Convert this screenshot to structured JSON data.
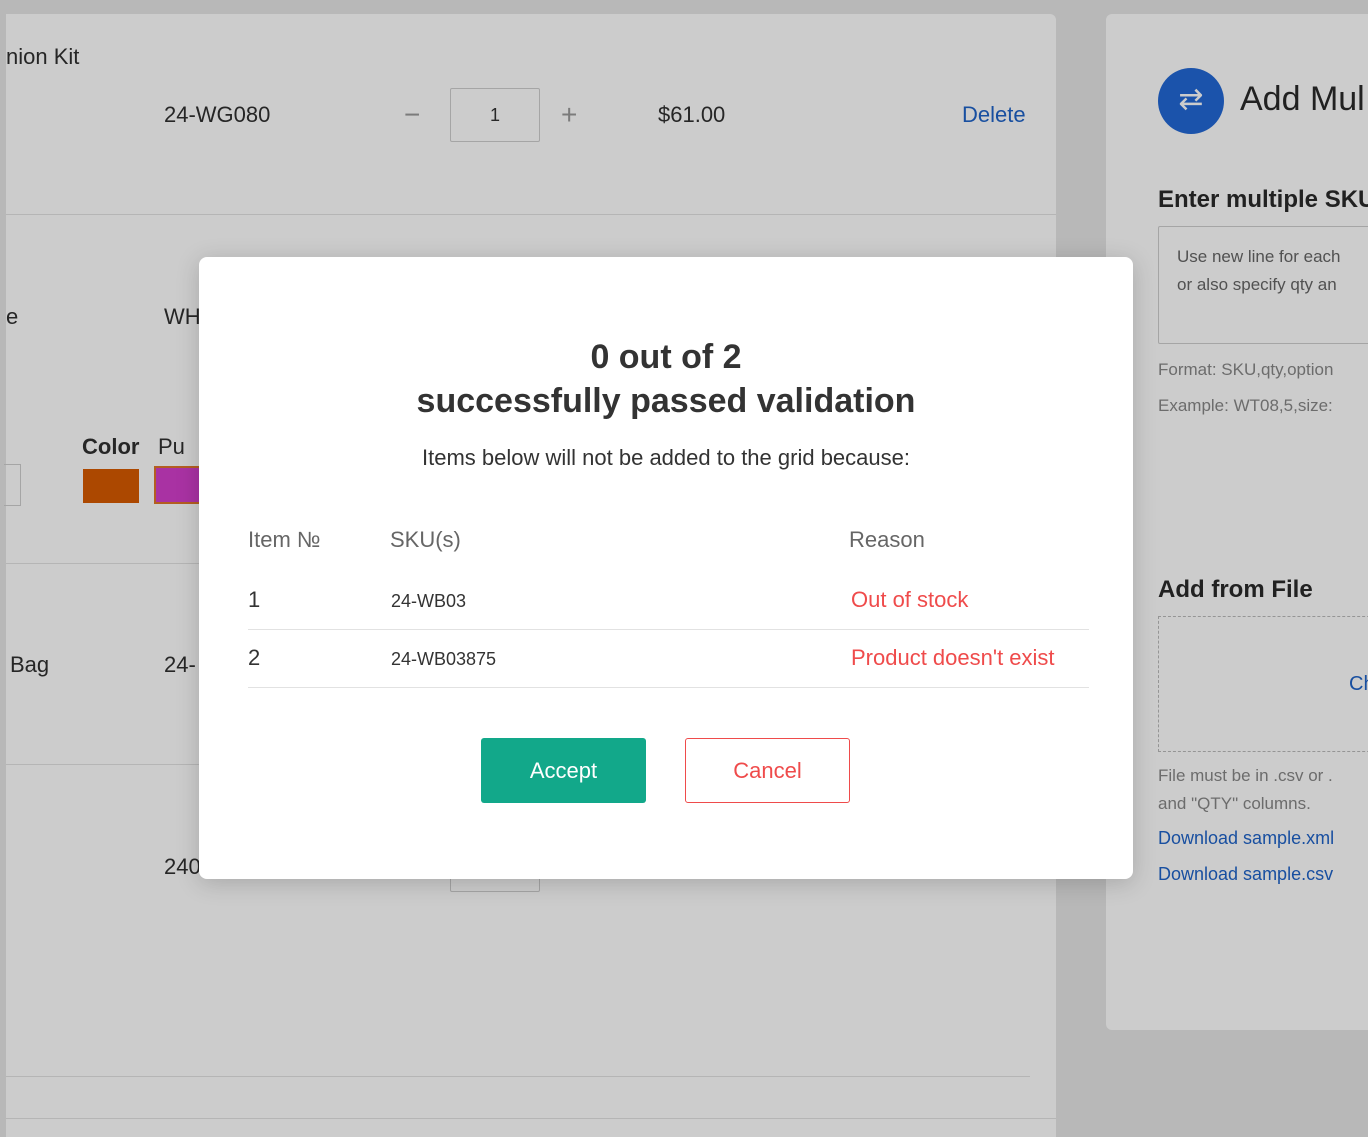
{
  "background": {
    "rows": [
      {
        "name_fragment": "nion Kit",
        "sku": "24-WG080",
        "qty": "1",
        "minus": "−",
        "plus": "+",
        "price": "$61.00",
        "delete_label": "Delete"
      },
      {
        "name_fragment": "e",
        "sku": "WH"
      },
      {
        "name_fragment": "Bag",
        "sku": "24-"
      },
      {
        "sku": "240"
      }
    ],
    "color_option": {
      "label": "Color",
      "value_fragment": "Pu"
    },
    "swatch_colors": [
      "#d85a00",
      "#d43fcc"
    ]
  },
  "right_panel": {
    "title": "Add Mul",
    "section_title": "Enter multiple SKU",
    "textarea_lines": [
      "Use new line for each",
      "or also specify qty an"
    ],
    "format_hint": "Format: SKU,qty,option",
    "example_hint": "Example: WT08,5,size:",
    "file_section_title": "Add from File",
    "dropzone_link": "Ch",
    "file_hint_lines": [
      "File must be in .csv or .",
      "and \"QTY\" columns."
    ],
    "download_xml": "Download sample.xml",
    "download_csv": "Download sample.csv"
  },
  "modal": {
    "title_line1": "0 out of 2",
    "title_line2": "successfully passed validation",
    "subtitle": "Items below will not be added to the grid because:",
    "columns": {
      "item": "Item №",
      "sku": "SKU(s)",
      "reason": "Reason"
    },
    "rows": [
      {
        "item": "1",
        "sku": "24-WB03",
        "reason": "Out of stock"
      },
      {
        "item": "2",
        "sku": "24-WB03875",
        "reason": "Product doesn't exist"
      }
    ],
    "accept_label": "Accept",
    "cancel_label": "Cancel"
  },
  "colors": {
    "accent": "#12a88a",
    "error": "#ef4b4b",
    "link": "#1f63c9"
  }
}
